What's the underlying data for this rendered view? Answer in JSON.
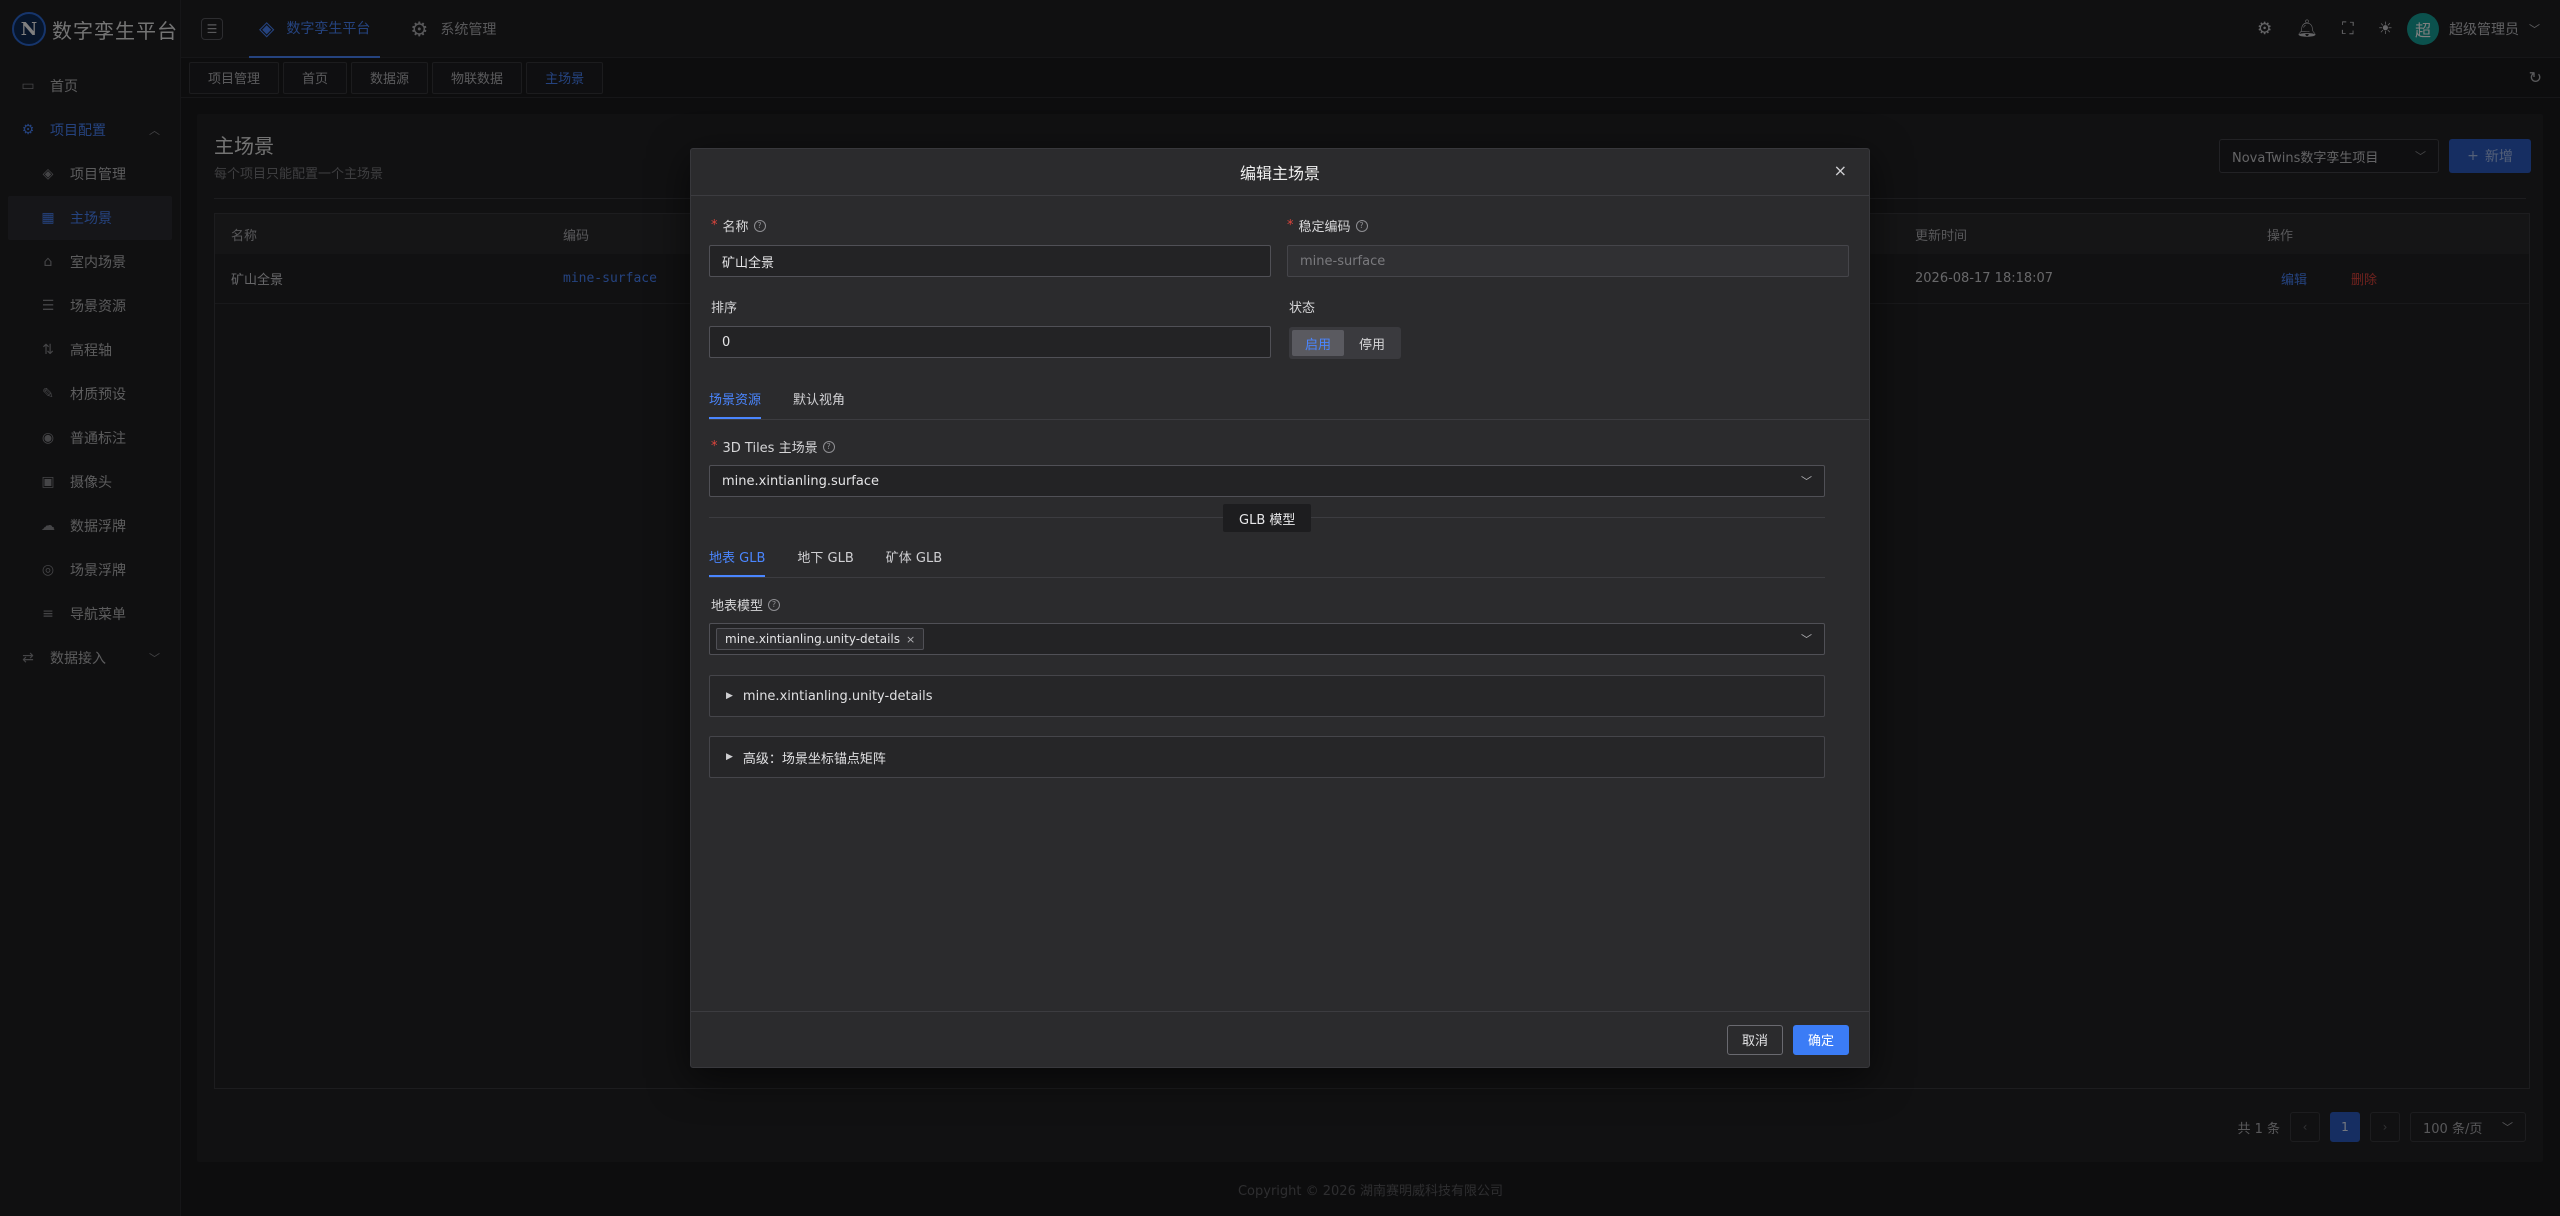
{
  "app": {
    "logo_letter": "N",
    "name": "数字孪生平台"
  },
  "top_nav": [
    {
      "label": "数字孪生平台",
      "icon": "layers-icon",
      "active": true
    },
    {
      "label": "系统管理",
      "icon": "gear-icon",
      "active": false
    }
  ],
  "user": {
    "avatar_char": "超",
    "name": "超级管理员"
  },
  "sidebar": {
    "items": [
      {
        "label": "首页",
        "icon": "monitor-icon",
        "type": "top"
      },
      {
        "label": "项目配置",
        "icon": "settings-icon",
        "type": "group-open"
      },
      {
        "label": "项目管理",
        "icon": "layers-icon",
        "type": "sub"
      },
      {
        "label": "主场景",
        "icon": "grid-icon",
        "type": "sub-active"
      },
      {
        "label": "室内场景",
        "icon": "home-icon",
        "type": "sub"
      },
      {
        "label": "场景资源",
        "icon": "database-icon",
        "type": "sub"
      },
      {
        "label": "高程轴",
        "icon": "axis-icon",
        "type": "sub"
      },
      {
        "label": "材质预设",
        "icon": "brush-icon",
        "type": "sub"
      },
      {
        "label": "普通标注",
        "icon": "pin-icon",
        "type": "sub"
      },
      {
        "label": "摄像头",
        "icon": "camera-icon",
        "type": "sub"
      },
      {
        "label": "数据浮牌",
        "icon": "cloud-icon",
        "type": "sub"
      },
      {
        "label": "场景浮牌",
        "icon": "location-icon",
        "type": "sub"
      },
      {
        "label": "导航菜单",
        "icon": "menu-icon",
        "type": "sub"
      },
      {
        "label": "数据接入",
        "icon": "exchange-icon",
        "type": "group"
      }
    ]
  },
  "page_tabs": [
    {
      "label": "项目管理",
      "active": false
    },
    {
      "label": "首页",
      "active": false
    },
    {
      "label": "数据源",
      "active": false
    },
    {
      "label": "物联数据",
      "active": false
    },
    {
      "label": "主场景",
      "active": true
    }
  ],
  "page": {
    "title": "主场景",
    "subtitle": "每个项目只能配置一个主场景",
    "project_select": "NovaTwins数字孪生项目",
    "new_button": "新增",
    "table": {
      "headers": [
        "名称",
        "编码",
        "更新时间",
        "操作"
      ],
      "rows": [
        {
          "name": "矿山全景",
          "code": "mine-surface",
          "updated": "2026-08-17 18:18:07",
          "edit": "编辑",
          "delete": "删除"
        }
      ]
    },
    "pager": {
      "total": "共 1 条",
      "current": "1",
      "page_size": "100 条/页"
    }
  },
  "footer": "Copyright © 2026 湖南赛明威科技有限公司",
  "modal": {
    "title": "编辑主场景",
    "name_label": "名称",
    "name_value": "矿山全景",
    "code_label": "稳定编码",
    "code_placeholder": "mine-surface",
    "order_label": "排序",
    "order_value": "0",
    "status_label": "状态",
    "status_options": [
      "启用",
      "停用"
    ],
    "status_selected": "启用",
    "tabs": [
      "场景资源",
      "默认视角"
    ],
    "tiles_label": "3D Tiles 主场景",
    "tiles_value": "mine.xintianling.surface",
    "glb_divider": "GLB 模型",
    "glb_tabs": [
      "地表 GLB",
      "地下 GLB",
      "矿体 GLB"
    ],
    "surface_model_label": "地表模型",
    "surface_model_chip": "mine.xintianling.unity-details",
    "collapse_items": [
      "mine.xintianling.unity-details",
      "高级：场景坐标锚点矩阵"
    ],
    "cancel": "取消",
    "confirm": "确定"
  }
}
